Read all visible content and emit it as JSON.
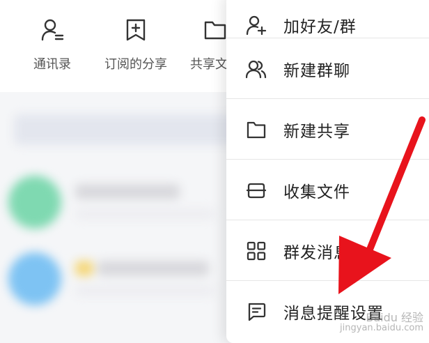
{
  "quick_actions": [
    {
      "label": "通讯录",
      "icon": "contacts-icon"
    },
    {
      "label": "订阅的分享",
      "icon": "bookmark-add-icon"
    },
    {
      "label": "共享文件",
      "icon": "folder-icon"
    }
  ],
  "menu": {
    "items": [
      {
        "label": "加好友/群",
        "icon": "add-friend-icon"
      },
      {
        "label": "新建群聊",
        "icon": "group-chat-icon"
      },
      {
        "label": "新建共享",
        "icon": "new-share-folder-icon"
      },
      {
        "label": "收集文件",
        "icon": "collect-files-icon"
      },
      {
        "label": "群发消息",
        "icon": "grid-broadcast-icon"
      },
      {
        "label": "消息提醒设置",
        "icon": "message-reminder-icon"
      }
    ]
  },
  "annotation": {
    "arrow_color": "#e8131c"
  },
  "colors": {
    "blur_green": "#7fd9b1",
    "blur_blue": "#7ec3f3",
    "blur_yellow": "#f5d77a"
  },
  "watermark": {
    "line1": "Baidu 经验",
    "line2": "jingyan.baidu.com"
  }
}
